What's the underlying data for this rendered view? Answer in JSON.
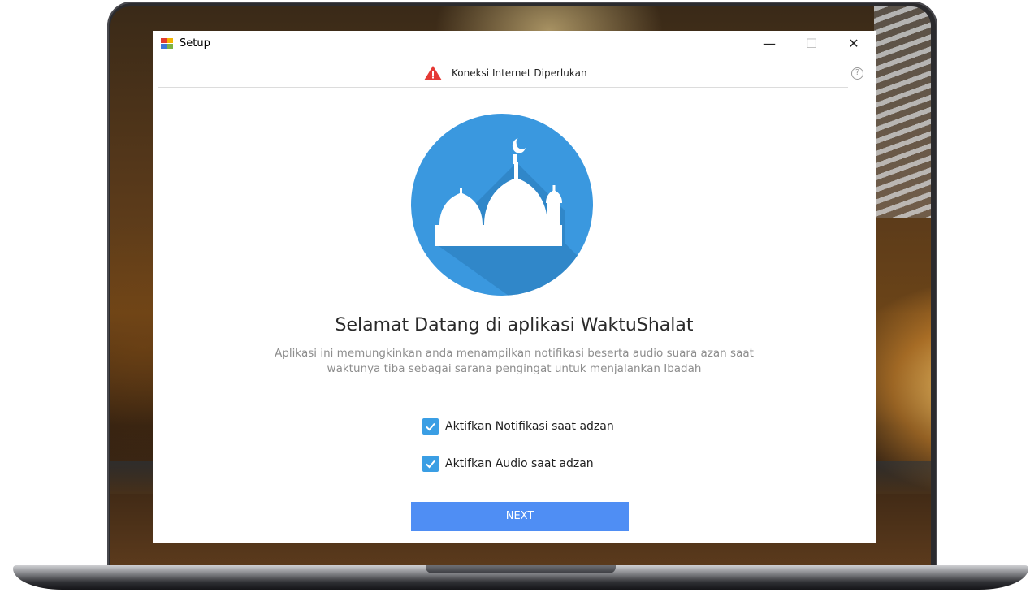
{
  "window": {
    "title": "Setup",
    "minimize_glyph": "—",
    "maximize_glyph": "☐",
    "close_glyph": "✕"
  },
  "notice": {
    "icon": "warning-icon",
    "text": "Koneksi Internet Diperlukan",
    "help_icon": "help-icon",
    "help_glyph": "?"
  },
  "logo": {
    "icon": "mosque-icon",
    "circle_color": "#3a98df",
    "shadow_color": "#2f84c6"
  },
  "welcome": {
    "headline": "Selamat Datang di aplikasi WaktuShalat",
    "description": "Aplikasi ini memungkinkan anda menampilkan notifikasi beserta audio suara azan saat waktunya tiba sebagai sarana pengingat untuk menjalankan Ibadah"
  },
  "options": [
    {
      "label": "Aktifkan Notifikasi saat adzan",
      "checked": true
    },
    {
      "label": "Aktifkan Audio saat adzan",
      "checked": true
    }
  ],
  "next_button": {
    "label": "NEXT",
    "color": "#4f8ef4"
  },
  "colors": {
    "checkbox": "#3a9ee4",
    "warning": "#e53935"
  }
}
